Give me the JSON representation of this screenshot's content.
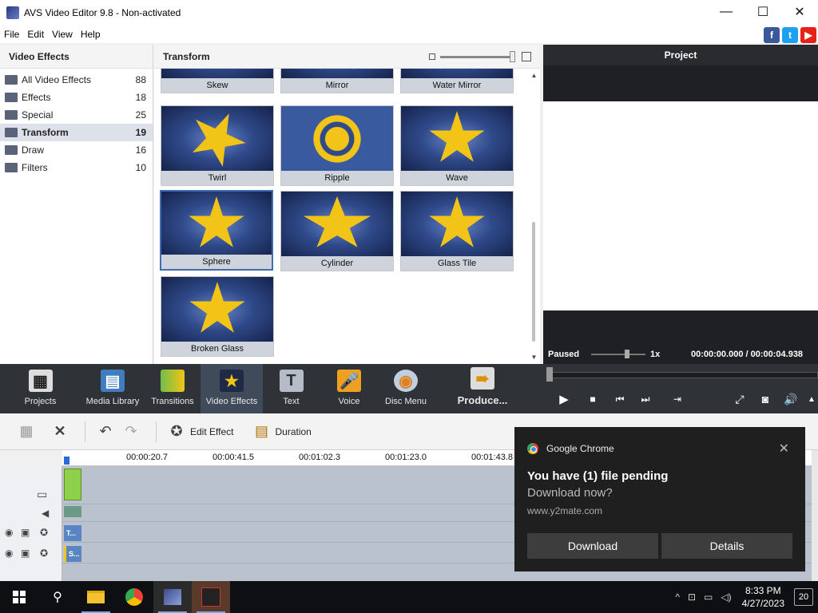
{
  "window": {
    "title": "AVS Video Editor 9.8 - Non-activated",
    "minimize": "—",
    "maximize": "☐",
    "close": "✕"
  },
  "menu": {
    "items": [
      "File",
      "Edit",
      "View",
      "Help"
    ]
  },
  "social": {
    "facebook": "f",
    "twitter": "t",
    "youtube": "▶"
  },
  "left_pane": {
    "title": "Video Effects",
    "categories": [
      {
        "label": "All Video Effects",
        "count": "88"
      },
      {
        "label": "Effects",
        "count": "18"
      },
      {
        "label": "Special",
        "count": "25"
      },
      {
        "label": "Transform",
        "count": "19",
        "selected": true
      },
      {
        "label": "Draw",
        "count": "16"
      },
      {
        "label": "Filters",
        "count": "10"
      }
    ]
  },
  "mid_pane": {
    "title": "Transform",
    "effects": [
      "Skew",
      "Mirror",
      "Water Mirror",
      "Twirl",
      "Ripple",
      "Wave",
      "Sphere",
      "Cylinder",
      "Glass Tile",
      "Broken Glass"
    ],
    "selected_effect": "Sphere"
  },
  "project": {
    "title": "Project",
    "status": "Paused",
    "speed": "1x",
    "time": "00:00:00.000  /  00:00:04.938"
  },
  "toolbar": {
    "items": [
      {
        "label": "Projects",
        "icon": "clapperboard-icon"
      },
      {
        "label": "Media Library",
        "icon": "film-icon"
      },
      {
        "label": "Transitions",
        "icon": "transition-icon"
      },
      {
        "label": "Video Effects",
        "icon": "star-icon",
        "active": true
      },
      {
        "label": "Text",
        "icon": "text-T-icon"
      },
      {
        "label": "Voice",
        "icon": "microphone-icon"
      },
      {
        "label": "Disc Menu",
        "icon": "disc-icon"
      },
      {
        "label": "Produce...",
        "icon": "produce-icon"
      }
    ]
  },
  "timeline": {
    "edit_effect": "Edit Effect",
    "duration": "Duration",
    "ruler": [
      "00:00:20.7",
      "00:00:41.5",
      "00:01:02.3",
      "00:01:23.0",
      "00:01:43.8"
    ],
    "clip_text": "T...",
    "clip_sphere": "S..."
  },
  "toast": {
    "app": "Google Chrome",
    "title": "You have (1) file pending",
    "subtitle": "Download now?",
    "url": "www.y2mate.com",
    "download": "Download",
    "details": "Details",
    "close": "✕"
  },
  "taskbar": {
    "time": "8:33 PM",
    "date": "4/27/2023",
    "notifications": "20"
  }
}
